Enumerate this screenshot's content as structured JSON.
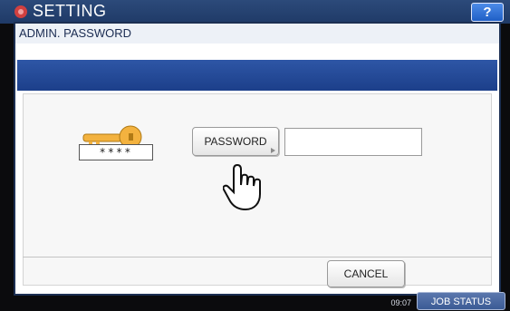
{
  "app": {
    "title": "SETTING",
    "help_label": "?"
  },
  "dialog": {
    "title": "ADMIN. PASSWORD",
    "masked_example": "****",
    "password_button_label": "PASSWORD",
    "password_value": "",
    "cancel_label": "CANCEL"
  },
  "status": {
    "time": "09:07",
    "job_status_label": "JOB STATUS"
  },
  "icons": {
    "setting": "setting-icon",
    "key": "key-icon",
    "pointer": "hand-pointer-icon"
  },
  "colors": {
    "header_blue": "#1f3a67",
    "dialog_bar_blue": "#1c3f8a",
    "key_gold": "#f3b23f"
  }
}
